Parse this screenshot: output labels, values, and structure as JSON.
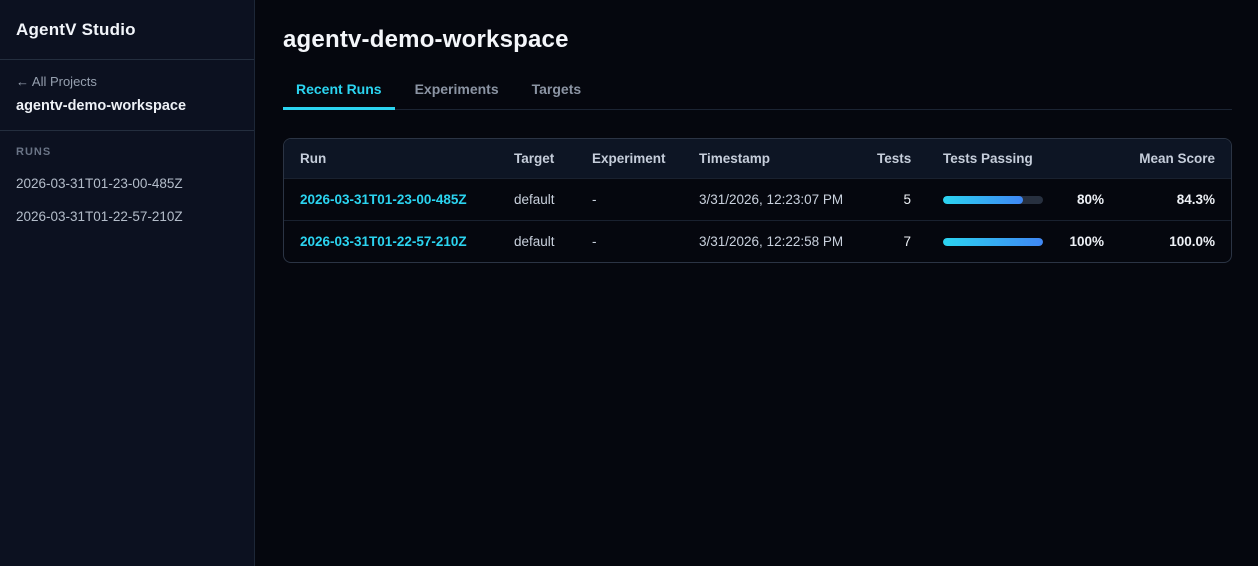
{
  "sidebar": {
    "app_title": "AgentV Studio",
    "back_link": "← All Projects",
    "workspace_name": "agentv-demo-workspace",
    "runs_label": "RUNS",
    "runs": [
      "2026-03-31T01-23-00-485Z",
      "2026-03-31T01-22-57-210Z"
    ]
  },
  "main": {
    "title": "agentv-demo-workspace",
    "tabs": [
      {
        "label": "Recent Runs",
        "active": true
      },
      {
        "label": "Experiments",
        "active": false
      },
      {
        "label": "Targets",
        "active": false
      }
    ],
    "table": {
      "columns": [
        "Run",
        "Target",
        "Experiment",
        "Timestamp",
        "Tests",
        "Tests Passing",
        "Mean Score"
      ],
      "rows": [
        {
          "run": "2026-03-31T01-23-00-485Z",
          "target": "default",
          "experiment": "-",
          "timestamp": "3/31/2026, 12:23:07 PM",
          "tests": "5",
          "tests_passing_pct": 80,
          "tests_passing_label": "80%",
          "mean_score": "84.3%"
        },
        {
          "run": "2026-03-31T01-22-57-210Z",
          "target": "default",
          "experiment": "-",
          "timestamp": "3/31/2026, 12:22:58 PM",
          "tests": "7",
          "tests_passing_pct": 100,
          "tests_passing_label": "100%",
          "mean_score": "100.0%"
        }
      ]
    }
  },
  "colors": {
    "accent_cyan": "#2bd4f0",
    "accent_blue": "#3f87f5",
    "progress_track": "#27303f"
  }
}
